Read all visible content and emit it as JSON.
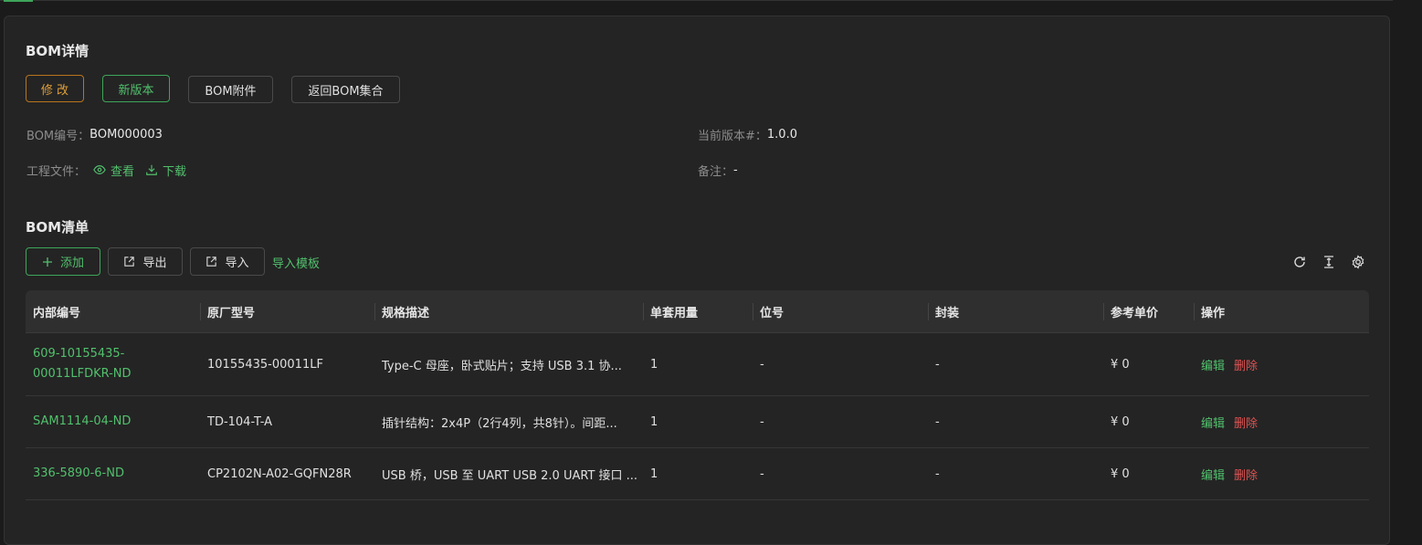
{
  "header": {
    "title": "BOM详情",
    "buttons": {
      "modify": "修 改",
      "new_version": "新版本",
      "attachments": "BOM附件",
      "back": "返回BOM集合"
    }
  },
  "info": {
    "bom_no_label": "BOM编号：",
    "bom_no_value": "BOM000003",
    "version_label": "当前版本#：",
    "version_value": "1.0.0",
    "project_file_label": "工程文件：",
    "view_label": "查看",
    "download_label": "下载",
    "remark_label": "备注：",
    "remark_value": "-"
  },
  "list": {
    "title": "BOM清单",
    "add_label": "添加",
    "export_label": "导出",
    "import_label": "导入",
    "template_label": "导入模板"
  },
  "table": {
    "columns": [
      "内部编号",
      "原厂型号",
      "规格描述",
      "单套用量",
      "位号",
      "封装",
      "参考单价",
      "操作"
    ],
    "rows": [
      {
        "code_line1": "609-10155435-",
        "code_line2": "00011LFDKR-ND",
        "model": "10155435-00011LF",
        "desc": "Type-C 母座，卧式贴片；支持 USB 3.1 协...",
        "qty": "1",
        "pos": "-",
        "pkg": "-",
        "price": "¥ 0",
        "edit": "编辑",
        "delete": "删除"
      },
      {
        "code_line1": "SAM1114-04-ND",
        "code_line2": "",
        "model": "TD-104-T-A",
        "desc": "插针结构：2x4P（2行4列，共8针）。间距...",
        "qty": "1",
        "pos": "-",
        "pkg": "-",
        "price": "¥ 0",
        "edit": "编辑",
        "delete": "删除"
      },
      {
        "code_line1": "336-5890-6-ND",
        "code_line2": "",
        "model": "CP2102N-A02-GQFN28R",
        "desc": "USB 桥，USB 至 UART USB 2.0 UART 接口 ...",
        "qty": "1",
        "pos": "-",
        "pkg": "-",
        "price": "¥ 0",
        "edit": "编辑",
        "delete": "删除"
      }
    ]
  },
  "colors": {
    "accent": "#52c06d",
    "warning": "#e0a03a",
    "danger": "#e05252",
    "card_bg": "#242424"
  }
}
